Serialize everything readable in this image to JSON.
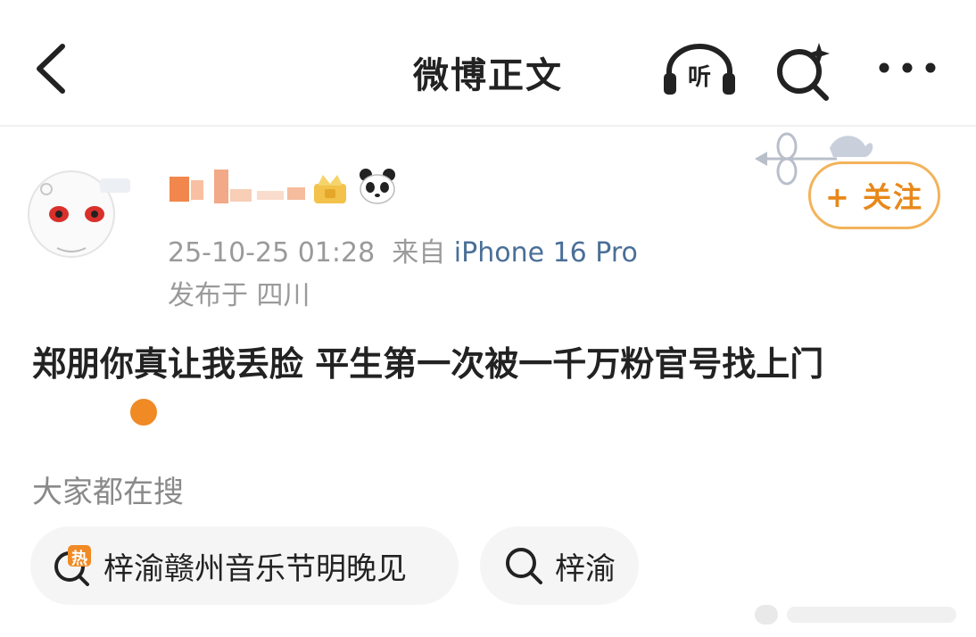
{
  "header": {
    "title": "微博正文",
    "listen_label": "听"
  },
  "post": {
    "username": "",
    "meta_line1_time": "25-10-25 01:28",
    "meta_line1_from": "来自",
    "meta_line1_source": "iPhone 16 Pro",
    "meta_line2": "发布于 四川",
    "follow_label": "+ 关注",
    "text": "郑朋你真让我丢脸 平生第一次被一千万粉官号找上门"
  },
  "search_section": {
    "label": "大家都在搜",
    "chips": [
      {
        "label": "梓渝赣州音乐节明晚见",
        "icon": "hot-search-icon",
        "icon_text": "热"
      },
      {
        "label": "梓渝",
        "icon": "search-icon"
      }
    ]
  },
  "colors": {
    "follow_border": "#f3b35a",
    "follow_text": "#e8881a",
    "source_link": "#4a6f98",
    "verified_badge": "#f08a24",
    "hot_icon": "#f08a24"
  }
}
